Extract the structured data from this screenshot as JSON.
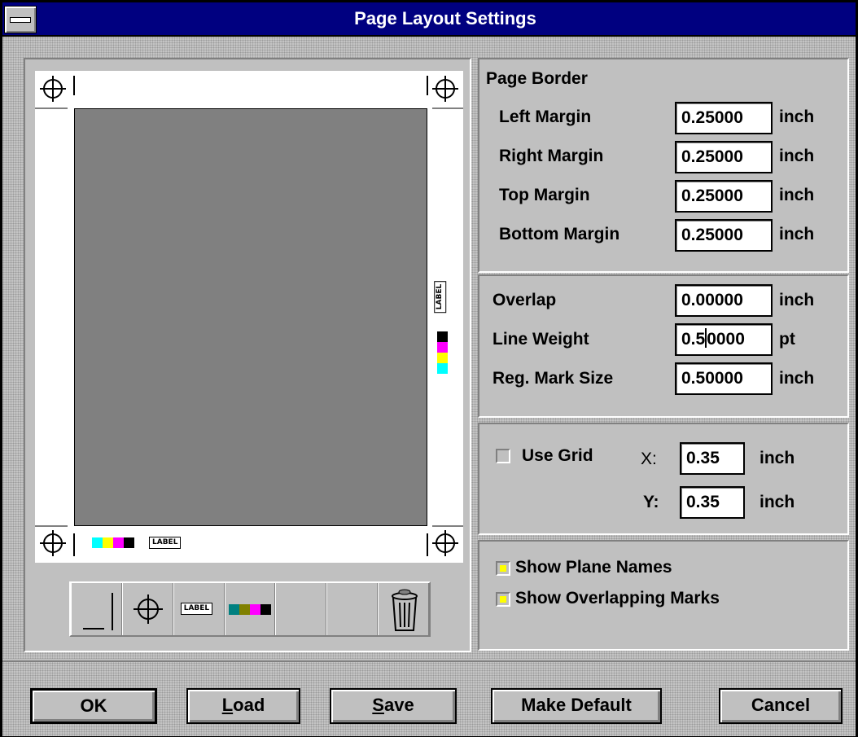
{
  "window": {
    "title": "Page Layout Settings"
  },
  "preview": {
    "label_mark_text": "LABEL",
    "swatch_colors": [
      "#00ffff",
      "#ffff00",
      "#ff00ff",
      "#000000"
    ],
    "tools": [
      {
        "name": "crop-mark-tool"
      },
      {
        "name": "registration-mark-tool"
      },
      {
        "name": "label-tool",
        "label": "LABEL"
      },
      {
        "name": "color-bar-tool"
      },
      {
        "name": "empty-tool-1"
      },
      {
        "name": "empty-tool-2"
      },
      {
        "name": "trash-icon"
      }
    ]
  },
  "page_border": {
    "heading": "Page Border",
    "left_label": "Left Margin",
    "left_value": "0.25000",
    "left_unit": "inch",
    "right_label": "Right Margin",
    "right_value": "0.25000",
    "right_unit": "inch",
    "top_label": "Top Margin",
    "top_value": "0.25000",
    "top_unit": "inch",
    "bottom_label": "Bottom Margin",
    "bottom_value": "0.25000",
    "bottom_unit": "inch"
  },
  "marks": {
    "overlap_label": "Overlap",
    "overlap_value": "0.00000",
    "overlap_unit": "inch",
    "lineweight_label": "Line Weight",
    "lineweight_before_cursor": "0.5",
    "lineweight_after_cursor": "0000",
    "lineweight_unit": "pt",
    "regmark_label": "Reg. Mark Size",
    "regmark_value": "0.50000",
    "regmark_unit": "inch"
  },
  "grid": {
    "use_grid_label": "Use Grid",
    "use_grid_checked": false,
    "x_label": "X:",
    "x_value": "0.35",
    "x_unit": "inch",
    "y_label": "Y:",
    "y_value": "0.35",
    "y_unit": "inch"
  },
  "options": {
    "show_plane_names": "Show Plane Names",
    "show_plane_names_checked": true,
    "show_overlapping": "Show Overlapping Marks",
    "show_overlapping_checked": true
  },
  "buttons": {
    "ok": "OK",
    "load_u": "L",
    "load_rest": "oad",
    "save_u": "S",
    "save_rest": "ave",
    "make_default": "Make Default",
    "cancel": "Cancel"
  }
}
